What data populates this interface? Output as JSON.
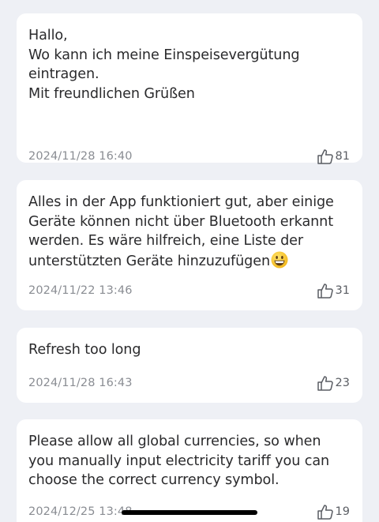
{
  "feedback": {
    "items": [
      {
        "message": "Hallo,\nWo kann ich meine Einspeisevergütung eintragen.\nMit freundlichen Grüßen",
        "date": "2024/11/28 16:40",
        "likes": "81"
      },
      {
        "message": "Alles in der App funktioniert gut, aber einige Geräte können nicht über Bluetooth erkannt werden. Es wäre hilfreich, eine Liste der unterstützten Geräte hinzuzufügen",
        "emoji": "grinning-face-emoji",
        "date": "2024/11/22 13:46",
        "likes": "31"
      },
      {
        "message": "Refresh too long",
        "date": "2024/11/28 16:43",
        "likes": "23"
      },
      {
        "message": "Please allow all global currencies, so when you manually input electricity tariff you can choose the correct currency symbol.",
        "date": "2024/12/25 13:48",
        "likes": "19"
      }
    ]
  },
  "icons": {
    "like": "thumbs-up-icon"
  },
  "colors": {
    "background": "#eef0f5",
    "card": "#ffffff",
    "text": "#2a2a2c",
    "meta": "#8a8d93"
  }
}
